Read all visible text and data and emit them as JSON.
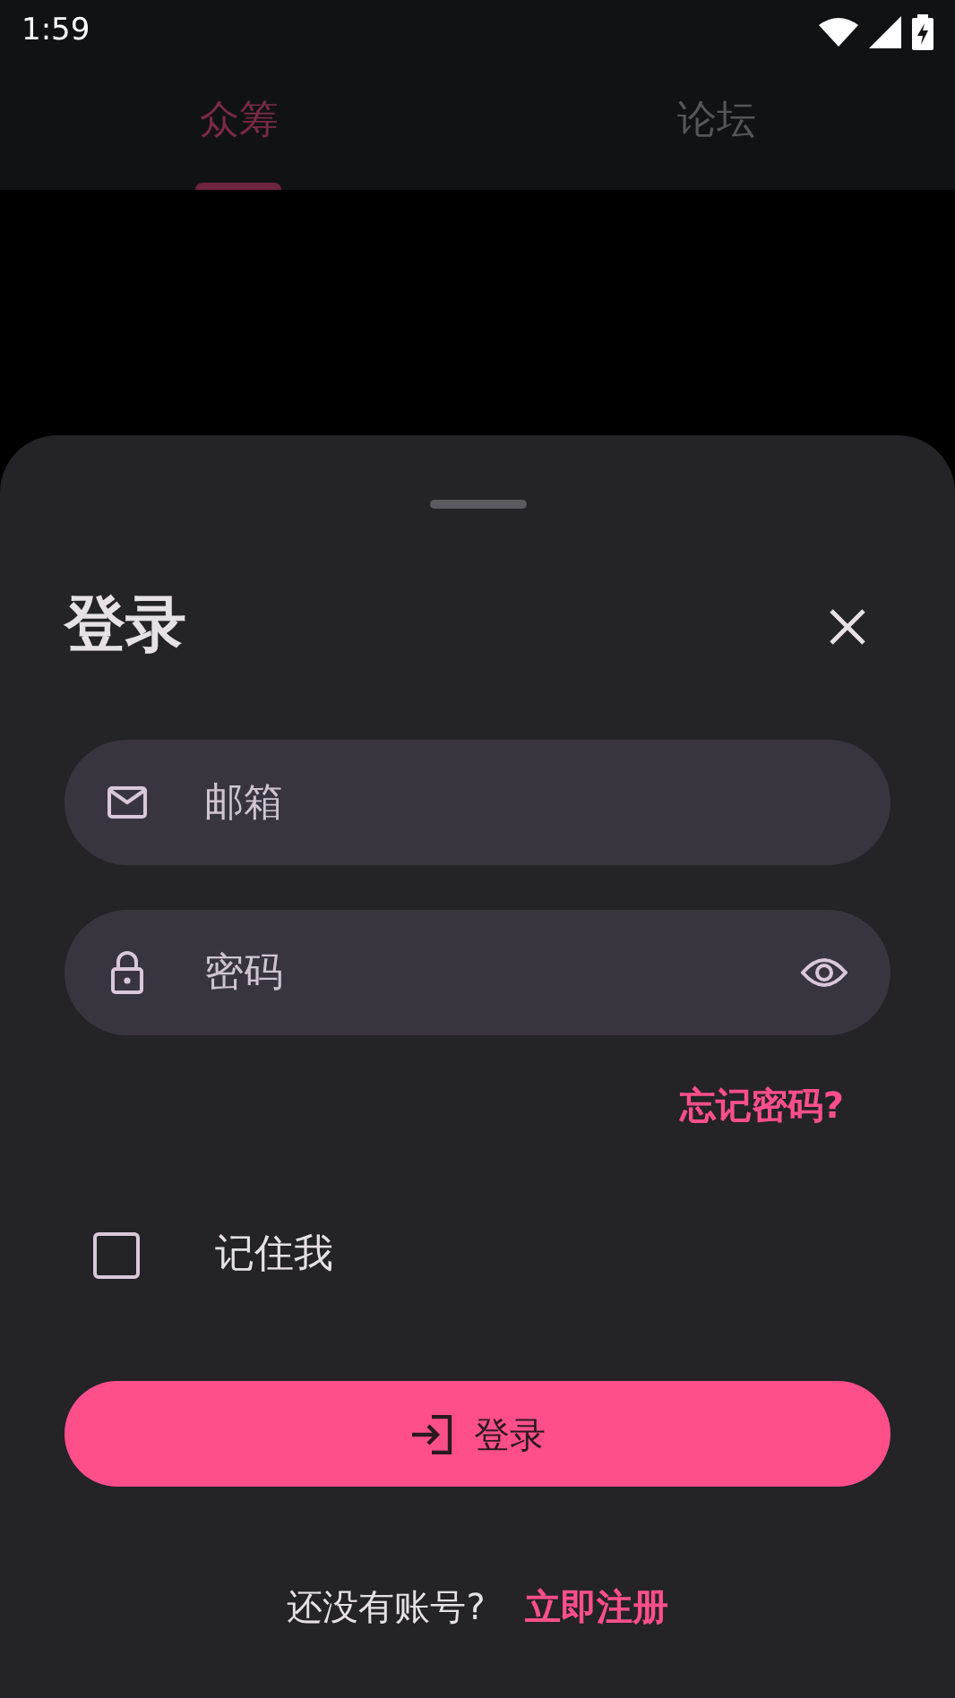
{
  "status_bar": {
    "time": "1:59"
  },
  "tabs": [
    {
      "label": "众筹",
      "selected": true
    },
    {
      "label": "论坛",
      "selected": false
    }
  ],
  "login_sheet": {
    "title": "登录",
    "email_field": {
      "placeholder": "邮箱"
    },
    "password_field": {
      "placeholder": "密码"
    },
    "forgot_password": "忘记密码?",
    "remember_me": {
      "label": "记住我",
      "checked": false
    },
    "login_button": "登录",
    "footer": {
      "prompt": "还没有账号?",
      "register_link": "立即注册"
    }
  }
}
